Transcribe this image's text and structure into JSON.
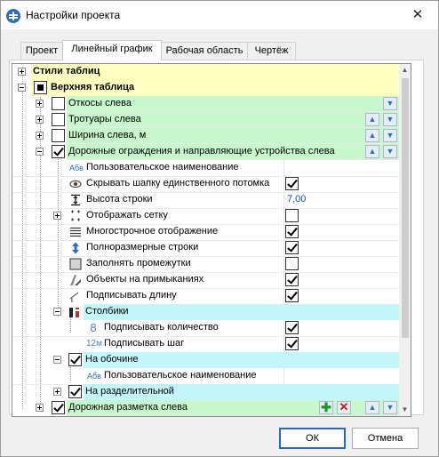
{
  "window": {
    "title": "Настройки проекта",
    "close_glyph": "✕"
  },
  "tabs": [
    {
      "label": "Проект"
    },
    {
      "label": "Линейный график"
    },
    {
      "label": "Рабочая область"
    },
    {
      "label": "Чертёж"
    }
  ],
  "active_tab": "Линейный график",
  "tree": {
    "rows": [
      {
        "label": "Стили таблиц",
        "bold": true
      },
      {
        "label": "Верхняя таблица",
        "bold": true
      },
      {
        "label": "Откосы слева"
      },
      {
        "label": "Тротуары слева"
      },
      {
        "label": "Ширина слева, м"
      },
      {
        "label": "Дорожные ограждения и направляющие устройства слева"
      },
      {
        "label": "Пользовательское наименование",
        "icon_text": "Абв"
      },
      {
        "label": "Скрывать шапку единственного потомка",
        "checked": true
      },
      {
        "label": "Высота строки",
        "value": "7,00"
      },
      {
        "label": "Отображать сетку",
        "checked": false
      },
      {
        "label": "Многострочное отображение",
        "checked": true
      },
      {
        "label": "Полноразмерные строки",
        "checked": true
      },
      {
        "label": "Заполнять промежутки",
        "checked": false
      },
      {
        "label": "Объекты на примыканиях",
        "checked": true
      },
      {
        "label": "Подписывать длину",
        "checked": true
      },
      {
        "label": "Столбики"
      },
      {
        "label": "Подписывать количество",
        "icon_text": "8",
        "checked": true
      },
      {
        "label": "Подписывать шаг",
        "icon_text": "12м",
        "checked": true
      },
      {
        "label": "На обочине"
      },
      {
        "label": "Пользовательское наименование",
        "icon_text": "Абв"
      },
      {
        "label": "На разделительной"
      },
      {
        "label": "Дорожная разметка слева"
      }
    ]
  },
  "buttons": {
    "ok": "ОК",
    "cancel": "Отмена"
  },
  "colors": {
    "yellow": "#ffffc0",
    "green": "#c9f7cd",
    "cyan": "#c2f6fb",
    "accent": "#2f6db6",
    "value": "#1c4fa0"
  },
  "icons": {
    "move_down": "▼",
    "move_up": "▲",
    "add": "✚",
    "delete": "✕",
    "scroll_up": "▲",
    "scroll_down": "▼"
  }
}
